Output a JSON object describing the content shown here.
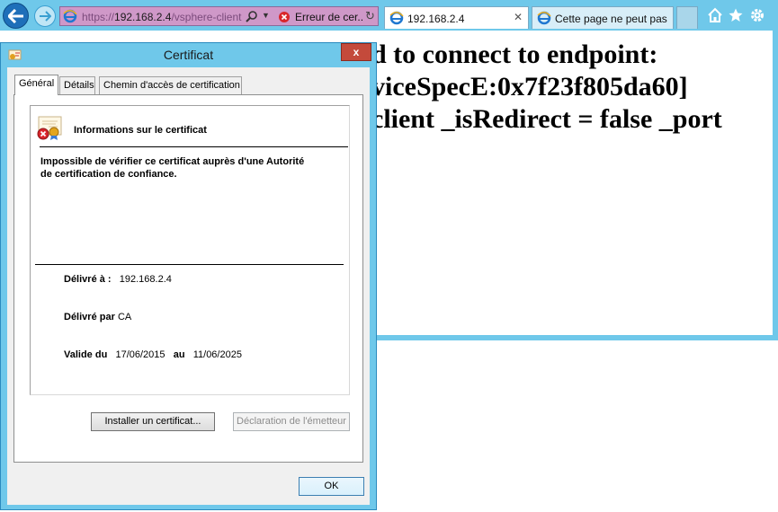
{
  "browser": {
    "address": {
      "url_prefix": "https://",
      "url_host": "192.168.2.4",
      "url_path": "/vsphere-client",
      "error_tab_label": "Erreur de cer..."
    },
    "tabs": [
      {
        "label": "192.168.2.4"
      },
      {
        "label": "Cette page ne peut pas ..."
      }
    ],
    "colors": {
      "chrome": "#6fc8ea",
      "address_bg": "#cf98c8",
      "error": "#d9262b"
    }
  },
  "page": {
    "lines": [
      "d to connect to endpoint:",
      "viceSpecE:0x7f23f805da60]",
      "client _isRedirect = false _port"
    ]
  },
  "dialog": {
    "title": "Certificat",
    "close_label": "x",
    "tabs": [
      "Général",
      "Détails",
      "Chemin d'accès de certification"
    ],
    "info_heading": "Informations sur le certificat",
    "info_message": "Impossible de vérifier ce certificat auprès d'une Autorité de certification de confiance.",
    "issued_to_label": "Délivré à :",
    "issued_to_value": "192.168.2.4",
    "issued_by_label": "Délivré par",
    "issued_by_value": "CA",
    "valid_from_label": "Valide du",
    "valid_from_value": "17/06/2015",
    "valid_to_label": "au",
    "valid_to_value": "11/06/2025",
    "install_button": "Installer un certificat...",
    "issuer_statement_button": "Déclaration de l'émetteur",
    "ok_button": "OK"
  }
}
